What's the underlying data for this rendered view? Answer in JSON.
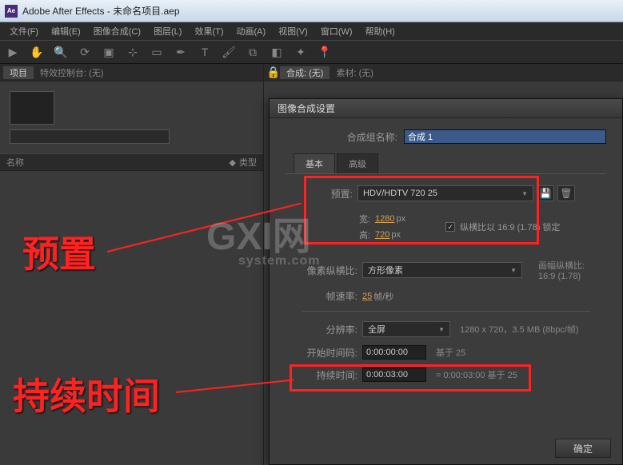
{
  "titlebar": {
    "app_icon": "Ae",
    "title": "Adobe After Effects - 未命名项目.aep"
  },
  "menus": [
    "文件(F)",
    "编辑(E)",
    "图像合成(C)",
    "图层(L)",
    "效果(T)",
    "动画(A)",
    "视图(V)",
    "窗口(W)",
    "帮助(H)"
  ],
  "left_tabs": {
    "project": "项目",
    "effects": "特效控制台: (无)"
  },
  "right_tabs": {
    "comp": "合成: (无)",
    "footage": "素材: (无)"
  },
  "project_cols": {
    "name": "名称",
    "type": "类型"
  },
  "dialog": {
    "title": "图像合成设置",
    "name_label": "合成组名称:",
    "name_value": "合成 1",
    "tab_basic": "基本",
    "tab_advanced": "高级",
    "preset_label": "预置:",
    "preset_value": "HDV/HDTV 720 25",
    "width_label": "宽:",
    "width_value": "1280",
    "height_label": "高:",
    "height_value": "720",
    "px": "px",
    "lock_aspect": "纵横比以 16:9 (1.78) 锁定",
    "par_label": "像素纵横比:",
    "par_value": "方形像素",
    "frame_aspect_label": "画幅纵横比:",
    "frame_aspect_value": "16:9 (1.78)",
    "fps_label": "帧速率:",
    "fps_value": "25",
    "fps_unit": "帧/秒",
    "res_label": "分辨率:",
    "res_value": "全屏",
    "res_info": "1280 x 720，3.5 MB (8bpc/帧)",
    "start_label": "开始时间码:",
    "start_value": "0:00:00:00",
    "start_info": "基于 25",
    "duration_label": "持续时间:",
    "duration_value": "0:00:03:00",
    "duration_info": "= 0:00:03:00  基于 25",
    "ok": "确定"
  },
  "annotations": {
    "preset": "预置",
    "duration": "持续时间"
  },
  "watermark": {
    "main": "GXI网",
    "sub": "system.com"
  }
}
